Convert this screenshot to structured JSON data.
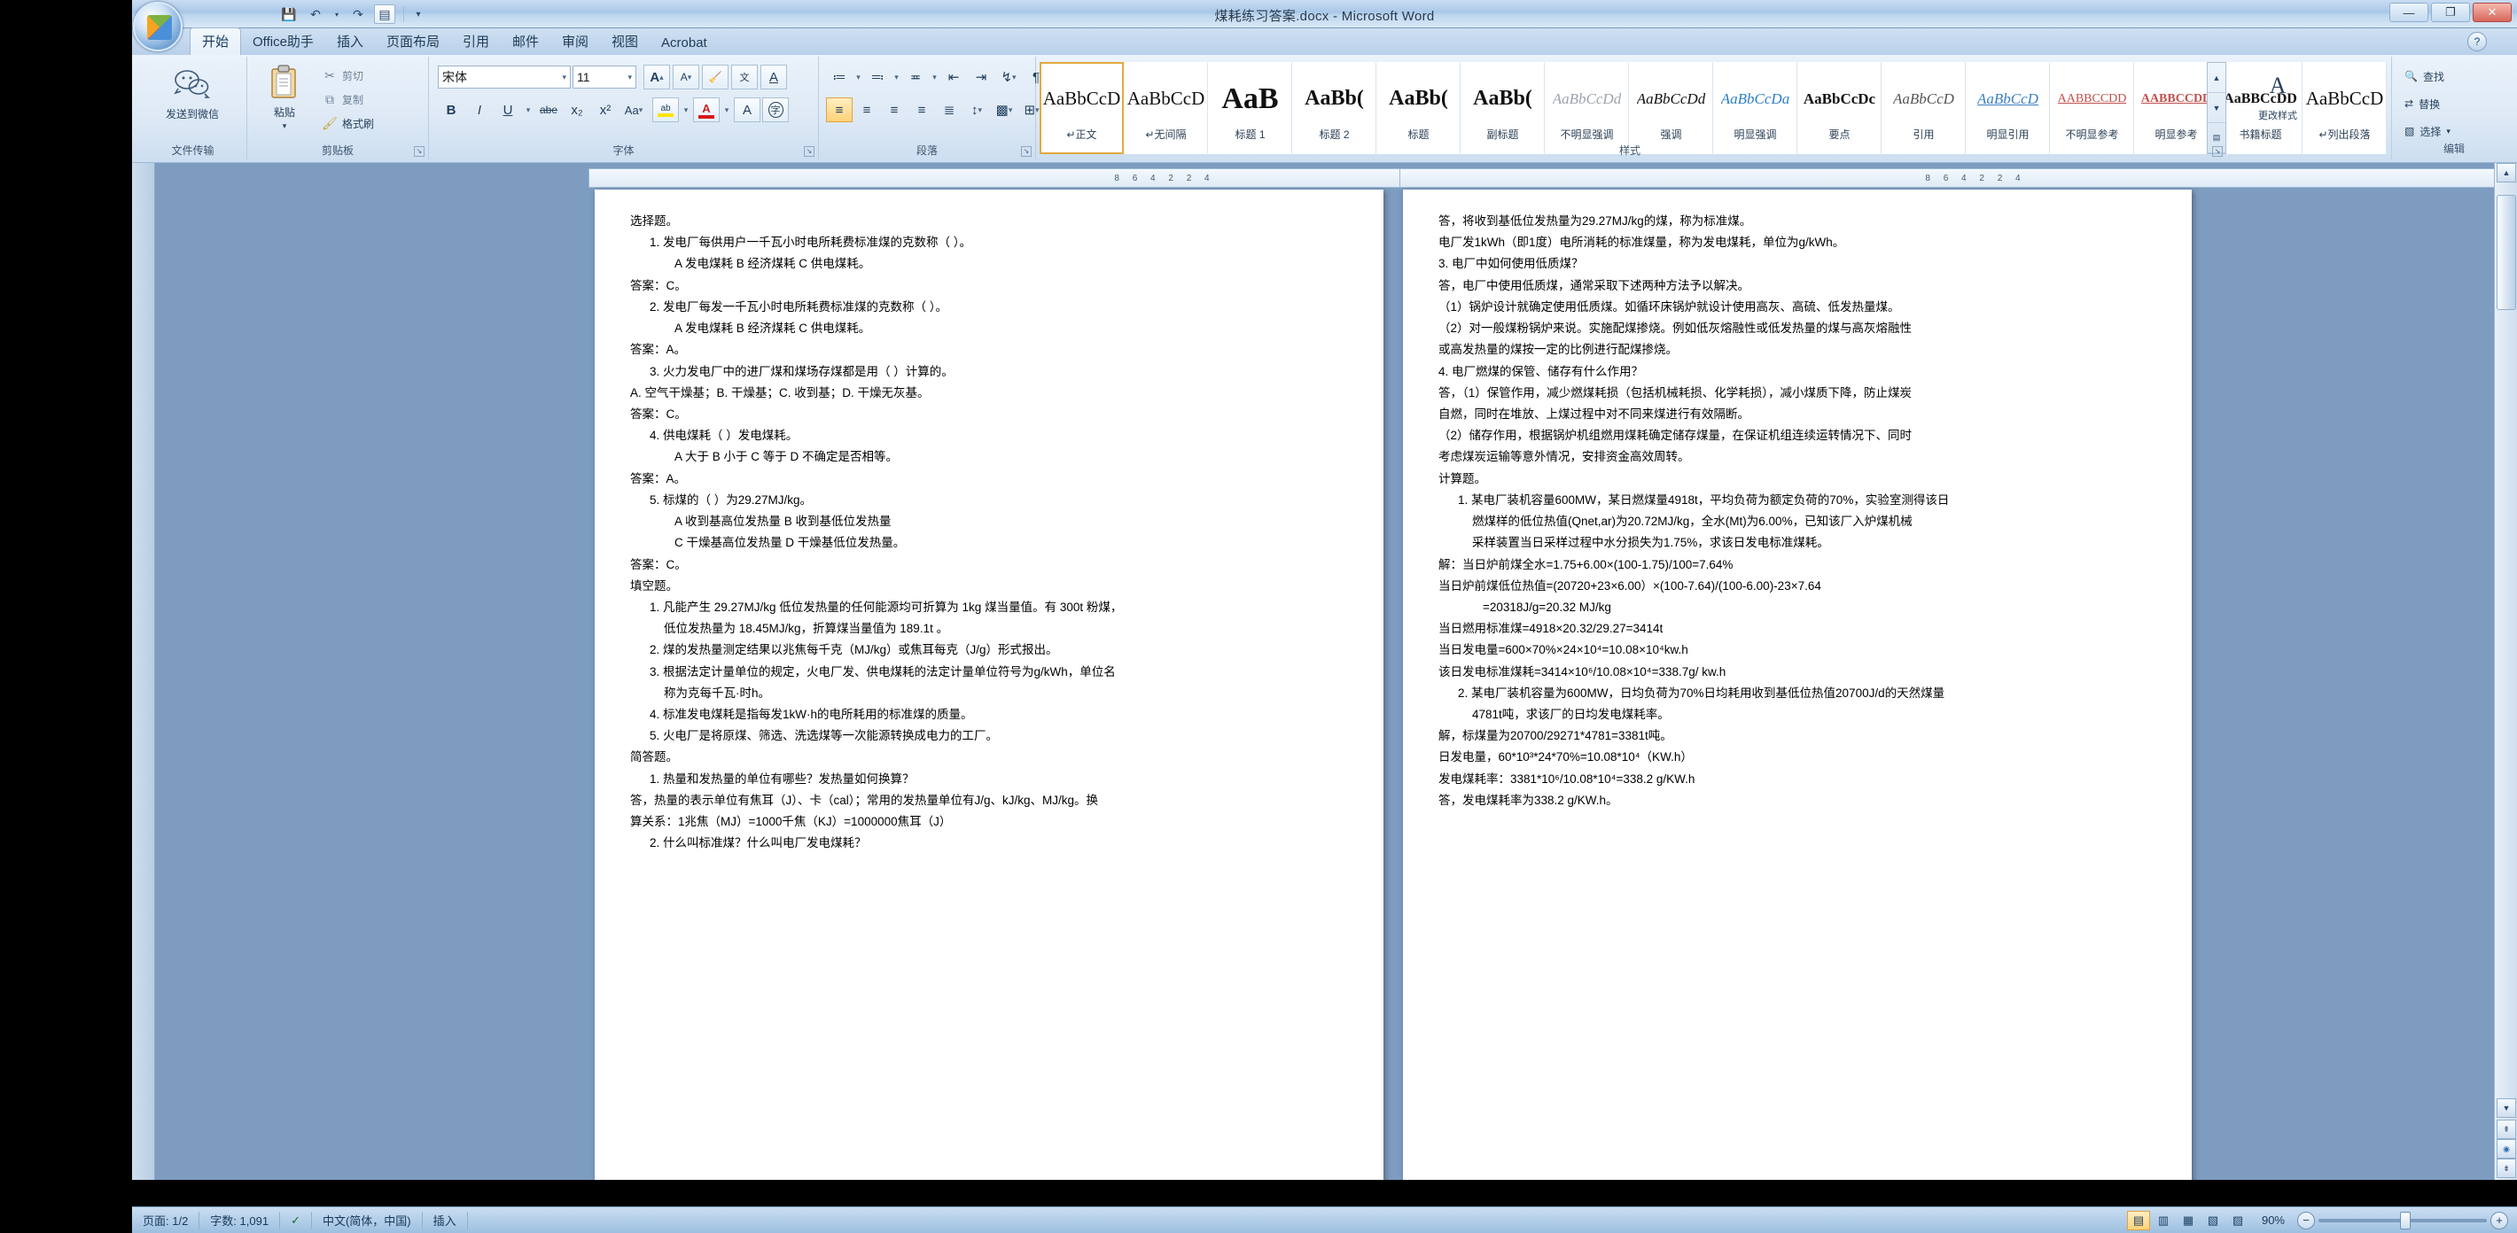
{
  "window": {
    "title": "煤耗练习答案.docx - Microsoft Word",
    "minimize": "—",
    "maximize": "❐",
    "close": "✕"
  },
  "qat": {
    "save": "💾",
    "undo": "↶",
    "undo_arrow": "▾",
    "redo": "↷",
    "quickprint": "▤",
    "customize": "▾"
  },
  "tabs": [
    {
      "label": "开始",
      "active": true
    },
    {
      "label": "Office助手",
      "active": false
    },
    {
      "label": "插入",
      "active": false
    },
    {
      "label": "页面布局",
      "active": false
    },
    {
      "label": "引用",
      "active": false
    },
    {
      "label": "邮件",
      "active": false
    },
    {
      "label": "审阅",
      "active": false
    },
    {
      "label": "视图",
      "active": false
    },
    {
      "label": "Acrobat",
      "active": false
    }
  ],
  "ribbon": {
    "groups": {
      "transfer": {
        "title": "文件传输",
        "button": "发送到微信",
        "icon": "wechat-icon"
      },
      "clipboard": {
        "title": "剪贴板",
        "paste": "粘贴",
        "paste_arrow": "▾",
        "cut": "剪切",
        "copy": "复制",
        "format_painter": "格式刷"
      },
      "font": {
        "title": "字体",
        "font_name": "宋体",
        "font_size": "11",
        "grow": "A",
        "shrink": "A",
        "clear_format": "A",
        "phonetic": "文",
        "char_border": "A",
        "bold": "B",
        "italic": "I",
        "underline": "U",
        "strikethrough": "abe",
        "subscript": "x₂",
        "superscript": "x²",
        "change_case": "Aa",
        "highlight": "ab",
        "font_color": "A",
        "char_shading": "A",
        "enclose": "字"
      },
      "paragraph": {
        "title": "段落",
        "bullets": "≔",
        "numbering": "≕",
        "multilevel": "≖",
        "decrease_indent": "⇤",
        "increase_indent": "⇥",
        "sort": "↯",
        "show_marks": "¶",
        "align_left": "≡",
        "align_center": "≡",
        "align_right": "≡",
        "justify": "≡",
        "distribute": "≣",
        "line_spacing": "↕",
        "shading": "▩",
        "borders": "⊞"
      },
      "styles": {
        "title": "样式",
        "change_styles": "更改样式",
        "change_styles_icon": "A",
        "nav_up": "▲",
        "nav_down": "▼",
        "nav_more": "▤",
        "items": [
          {
            "preview": "AaBbCcD",
            "name": "↵正文",
            "selected": true
          },
          {
            "preview": "AaBbCcD",
            "name": "↵无间隔",
            "selected": false
          },
          {
            "preview": "AaB",
            "name": "标题 1",
            "selected": false
          },
          {
            "preview": "AaBb(",
            "name": "标题 2",
            "selected": false
          },
          {
            "preview": "AaBb(",
            "name": "标题",
            "selected": false
          },
          {
            "preview": "AaBb(",
            "name": "副标题",
            "selected": false
          },
          {
            "preview": "AaBbCcDd",
            "name": "不明显强调",
            "selected": false
          },
          {
            "preview": "AaBbCcDd",
            "name": "强调",
            "selected": false
          },
          {
            "preview": "AaBbCcDa",
            "name": "明显强调",
            "selected": false
          },
          {
            "preview": "AaBbCcDc",
            "name": "要点",
            "selected": false
          },
          {
            "preview": "AaBbCcD",
            "name": "引用",
            "selected": false
          },
          {
            "preview": "AaBbCcD",
            "name": "明显引用",
            "selected": false
          },
          {
            "preview": "AABBCCDD",
            "name": "不明显参考",
            "selected": false
          },
          {
            "preview": "AABBCCDD",
            "name": "明显参考",
            "selected": false
          },
          {
            "preview": "AaBBCcDD",
            "name": "书籍标题",
            "selected": false
          },
          {
            "preview": "AaBbCcD",
            "name": "↵列出段落",
            "selected": false
          }
        ]
      },
      "editing": {
        "title": "编辑",
        "find": "查找",
        "find_icon": "🔍",
        "replace": "替换",
        "replace_icon": "⇄",
        "select": "选择",
        "select_icon": "▧",
        "select_arrow": "▾"
      }
    }
  },
  "ruler": {
    "left_marks": "8  6  4  2     2  4",
    "right_marks": "8  6  4  2     2  4"
  },
  "document": {
    "left_page": [
      {
        "t": "选择题。",
        "ind": 0
      },
      {
        "t": "1.  发电厂每供用户一千瓦小时电所耗费标准煤的克数称（   ）。",
        "ind": 1
      },
      {
        "t": "A  发电煤耗      B  经济煤耗        C  供电煤耗。",
        "ind": 2
      },
      {
        "t": "答案：C。",
        "ind": 0
      },
      {
        "t": "2.  发电厂每发一千瓦小时电所耗费标准煤的克数称（   ）。",
        "ind": 1
      },
      {
        "t": "A  发电煤耗      B  经济煤耗      C  供电煤耗。",
        "ind": 2
      },
      {
        "t": "答案：A。",
        "ind": 0
      },
      {
        "t": "3.  火力发电厂中的进厂煤和煤场存煤都是用（        ）计算的。",
        "ind": 1
      },
      {
        "t": "A. 空气干燥基；B. 干燥基；C. 收到基；D. 干燥无灰基。",
        "ind": 0
      },
      {
        "t": "答案：C。",
        "ind": 0
      },
      {
        "t": "4.  供电煤耗（  ）发电煤耗。",
        "ind": 1
      },
      {
        "t": "A  大于        B  小于        C  等于     D  不确定是否相等。",
        "ind": 2
      },
      {
        "t": "答案：A。",
        "ind": 0
      },
      {
        "t": "5.  标煤的（  ）为29.27MJ/kg。",
        "ind": 1
      },
      {
        "t": "A  收到基高位发热量        B  收到基低位发热量",
        "ind": 2
      },
      {
        "t": "C  干燥基高位发热量     D  干燥基低位发热量。",
        "ind": 2
      },
      {
        "t": "答案：C。",
        "ind": 0
      },
      {
        "t": "填空题。",
        "ind": 0
      },
      {
        "t": "1.  凡能产生 29.27MJ/kg 低位发热量的任何能源均可折算为 1kg 煤当量值。有 300t 粉煤，",
        "ind": 1
      },
      {
        "t": "低位发热量为 18.45MJ/kg，折算煤当量值为 189.1t  。",
        "ind": 3
      },
      {
        "t": "2.  煤的发热量测定结果以兆焦每千克（MJ/kg）或焦耳每克（J/g）形式报出。",
        "ind": 1
      },
      {
        "t": "3.  根据法定计量单位的规定，火电厂发、供电煤耗的法定计量单位符号为g/kWh，单位名",
        "ind": 1
      },
      {
        "t": "称为克每千瓦·时h。",
        "ind": 3
      },
      {
        "t": "4.  标准发电煤耗是指每发1kW·h的电所耗用的标准煤的质量。",
        "ind": 1
      },
      {
        "t": "5.  火电厂是将原煤、筛选、洗选煤等一次能源转换成电力的工厂。",
        "ind": 1
      },
      {
        "t": "简答题。",
        "ind": 0
      },
      {
        "t": "1.  热量和发热量的单位有哪些？发热量如何换算？",
        "ind": 1
      },
      {
        "t": "答，热量的表示单位有焦耳（J）、卡（cal）；常用的发热量单位有J/g、kJ/kg、MJ/kg。换",
        "ind": 0
      },
      {
        "t": "算关系：1兆焦（MJ）=1000千焦（KJ）=1000000焦耳（J）",
        "ind": 0
      },
      {
        "t": "2.  什么叫标准煤？什么叫电厂发电煤耗？",
        "ind": 1
      }
    ],
    "right_page": [
      {
        "t": "答，将收到基低位发热量为29.27MJ/kg的煤，称为标准煤。",
        "ind": 0
      },
      {
        "t": "电厂发1kWh（即1度）电所消耗的标准煤量，称为发电煤耗，单位为g/kWh。",
        "ind": 0
      },
      {
        "t": "3.   电厂中如何使用低质煤？",
        "ind": 0
      },
      {
        "t": "答，电厂中使用低质煤，通常采取下述两种方法予以解决。",
        "ind": 0
      },
      {
        "t": "（1）锅炉设计就确定使用低质煤。如循环床锅炉就设计使用高灰、高硫、低发热量煤。",
        "ind": 0
      },
      {
        "t": "（2）对一般煤粉锅炉来说。实施配煤掺烧。例如低灰熔融性或低发热量的煤与高灰熔融性",
        "ind": 0
      },
      {
        "t": "或高发热量的煤按一定的比例进行配煤掺烧。",
        "ind": 0
      },
      {
        "t": "4.   电厂燃煤的保管、储存有什么作用？",
        "ind": 0
      },
      {
        "t": "答，（1）保管作用，减少燃煤耗损（包括机械耗损、化学耗损），减小煤质下降，防止煤炭",
        "ind": 0
      },
      {
        "t": "自燃，同时在堆放、上煤过程中对不同来煤进行有效隔断。",
        "ind": 0
      },
      {
        "t": "（2）储存作用，根据锅炉机组燃用煤耗确定储存煤量，在保证机组连续运转情况下、同时",
        "ind": 0
      },
      {
        "t": "考虑煤炭运输等意外情况，安排资金高效周转。",
        "ind": 0
      },
      {
        "t": "计算题。",
        "ind": 0
      },
      {
        "t": "1.  某电厂装机容量600MW，某日燃煤量4918t，平均负荷为额定负荷的70%，实验室测得该日",
        "ind": 1
      },
      {
        "t": "燃煤样的低位热值(Qnet,ar)为20.72MJ/kg，全水(Mt)为6.00%，已知该厂入炉煤机械",
        "ind": 3
      },
      {
        "t": "采样装置当日采样过程中水分损失为1.75%，求该日发电标准煤耗。",
        "ind": 3
      },
      {
        "t": "解：当日炉前煤全水=1.75+6.00×(100-1.75)/100=7.64%",
        "ind": 0
      },
      {
        "t": "当日炉前煤低位热值=(20720+23×6.00）×(100-7.64)/(100-6.00)-23×7.64",
        "ind": 0
      },
      {
        "t": "=20318J/g=20.32 MJ/kg",
        "ind": 2
      },
      {
        "t": "当日燃用标准煤=4918×20.32/29.27=3414t",
        "ind": 0
      },
      {
        "t": "当日发电量=600×70%×24×10⁴=10.08×10⁴kw.h",
        "ind": 0
      },
      {
        "t": "该日发电标准煤耗=3414×10⁶/10.08×10⁴=338.7g/ kw.h",
        "ind": 0
      },
      {
        "t": "2.  某电厂装机容量为600MW，日均负荷为70%日均耗用收到基低位热值20700J/d的天然煤量",
        "ind": 1
      },
      {
        "t": "4781t吨，求该厂的日均发电煤耗率。",
        "ind": 3
      },
      {
        "t": "解，标煤量为20700/29271*4781=3381t吨。",
        "ind": 0
      },
      {
        "t": "日发电量，60*10³*24*70%=10.08*10⁴（KW.h）",
        "ind": 0
      },
      {
        "t": "发电煤耗率：3381*10⁶/10.08*10⁴=338.2 g/KW.h",
        "ind": 0
      },
      {
        "t": "答，发电煤耗率为338.2 g/KW.h。",
        "ind": 0
      }
    ]
  },
  "status": {
    "page": "页面: 1/2",
    "words": "字数: 1,091",
    "proofing_icon": "✓",
    "language": "中文(简体，中国)",
    "insert_mode": "插入",
    "zoom": "90%",
    "zoom_out": "−",
    "zoom_in": "+",
    "views": [
      {
        "icon": "▤",
        "name": "print-layout-view",
        "active": true
      },
      {
        "icon": "▥",
        "name": "full-screen-reading-view",
        "active": false
      },
      {
        "icon": "▦",
        "name": "web-layout-view",
        "active": false
      },
      {
        "icon": "▧",
        "name": "outline-view",
        "active": false
      },
      {
        "icon": "▨",
        "name": "draft-view",
        "active": false
      }
    ]
  },
  "scroll": {
    "up_arrow": "▲",
    "down_arrow": "▼",
    "prev_page": "⇞",
    "next_page": "⇟",
    "browse_object": "◉"
  },
  "help": {
    "icon": "?"
  }
}
